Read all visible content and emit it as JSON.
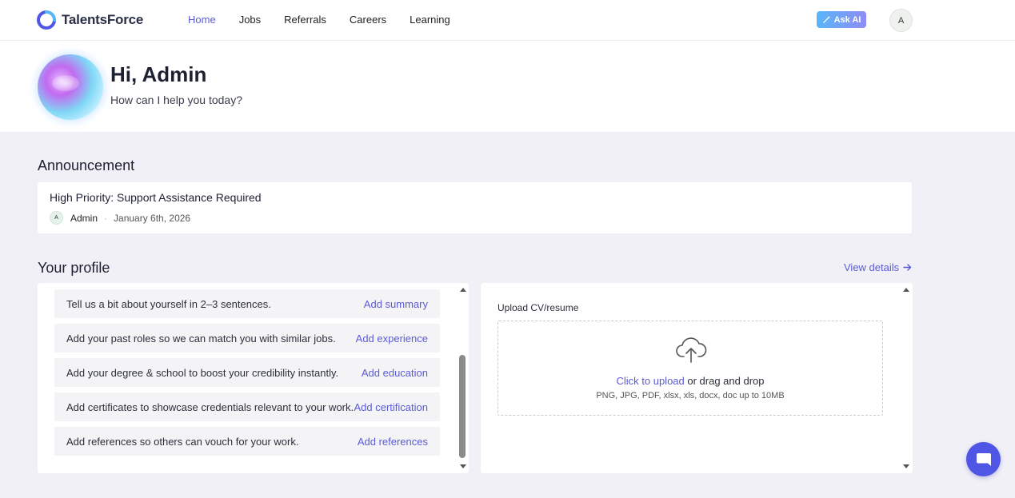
{
  "header": {
    "brand": "TalentsForce",
    "nav": [
      {
        "label": "Home",
        "active": true
      },
      {
        "label": "Jobs"
      },
      {
        "label": "Referrals"
      },
      {
        "label": "Careers"
      },
      {
        "label": "Learning"
      }
    ],
    "ask_ai": "Ask AI",
    "avatar_initial": "A",
    "accent_color": "#5b5bd6"
  },
  "hero": {
    "greeting": "Hi, Admin",
    "subtitle": "How can I help you today?"
  },
  "announcement": {
    "section_title": "Announcement",
    "title": "High Priority: Support Assistance Required",
    "author_initial": "A",
    "author": "Admin",
    "separator": "·",
    "date": "January 6th, 2026"
  },
  "profile": {
    "section_title": "Your profile",
    "view_details": "View details",
    "tasks": [
      {
        "text": "Tell us a bit about yourself in 2–3 sentences.",
        "action": "Add summary"
      },
      {
        "text": "Add your past roles so we can match you with similar jobs.",
        "action": "Add experience"
      },
      {
        "text": "Add your degree & school to boost your credibility instantly.",
        "action": "Add education"
      },
      {
        "text": "Add certificates to showcase credentials relevant to your work.",
        "action": "Add certification"
      },
      {
        "text": "Add references so others can vouch for your work.",
        "action": "Add references"
      }
    ],
    "upload": {
      "label": "Upload CV/resume",
      "click_text": "Click to upload",
      "drag_text": " or drag and drop",
      "hint": "PNG, JPG, PDF, xlsx, xls, docx, doc up to 10MB"
    }
  }
}
